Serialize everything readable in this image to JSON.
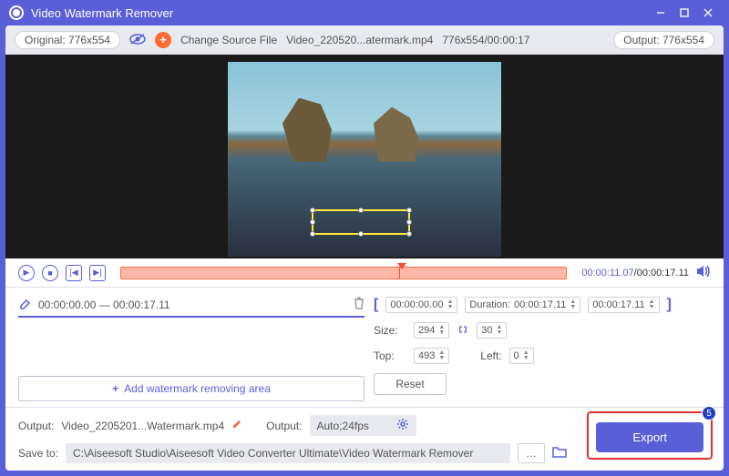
{
  "titlebar": {
    "title": "Video Watermark Remover"
  },
  "topbar": {
    "original": "Original: 776x554",
    "changeSource": "Change Source File",
    "filename": "Video_220520...atermark.mp4",
    "fileinfo": "776x554/00:00:17",
    "output": "Output: 776x554"
  },
  "playback": {
    "current": "00:00:11.07",
    "total": "00:00:17.11"
  },
  "range": {
    "text": "00:00:00.00 — 00:00:17.11"
  },
  "addArea": "Add watermark removing area",
  "trim": {
    "start": "00:00:00.00",
    "durationLabel": "Duration:",
    "duration": "00:00:17.11",
    "end": "00:00:17.11"
  },
  "size": {
    "label": "Size:",
    "w": "294",
    "h": "30"
  },
  "pos": {
    "topLabel": "Top:",
    "top": "493",
    "leftLabel": "Left:",
    "left": "0"
  },
  "reset": "Reset",
  "bottom": {
    "outputLabel": "Output:",
    "outputFile": "Video_2205201...Watermark.mp4",
    "outputLabel2": "Output:",
    "autoText": "Auto;24fps",
    "saveLabel": "Save to:",
    "savePath": "C:\\Aiseesoft Studio\\Aiseesoft Video Converter Ultimate\\Video Watermark Remover"
  },
  "export": {
    "label": "Export",
    "step": "5"
  }
}
